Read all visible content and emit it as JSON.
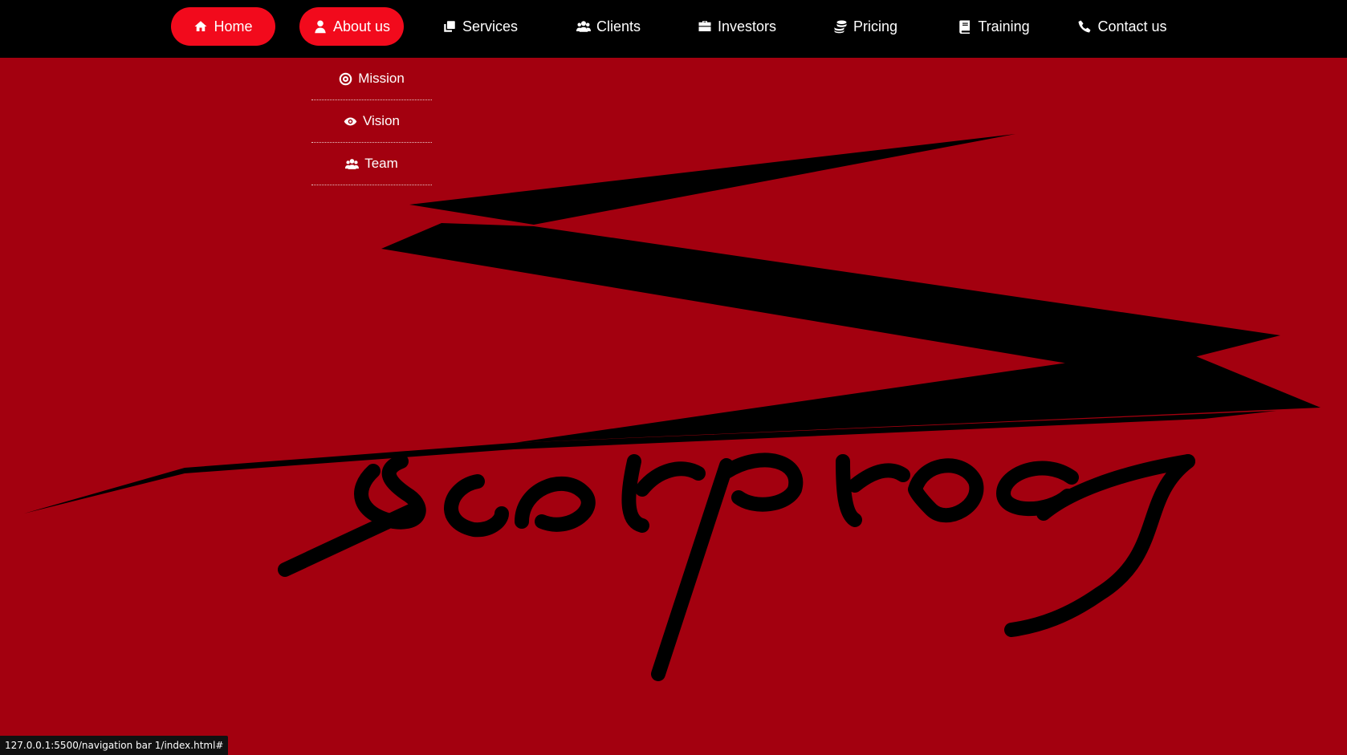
{
  "nav": {
    "items": [
      {
        "label": "Home",
        "icon": "home-icon"
      },
      {
        "label": "About us",
        "icon": "user-icon"
      },
      {
        "label": "Services",
        "icon": "copy-icon"
      },
      {
        "label": "Clients",
        "icon": "users-icon"
      },
      {
        "label": "Investors",
        "icon": "briefcase-icon"
      },
      {
        "label": "Pricing",
        "icon": "coins-icon"
      },
      {
        "label": "Training",
        "icon": "book-icon"
      },
      {
        "label": "Contact us",
        "icon": "phone-icon"
      }
    ]
  },
  "dropdown": {
    "items": [
      {
        "label": "Mission",
        "icon": "target-icon"
      },
      {
        "label": "Vision",
        "icon": "eye-icon"
      },
      {
        "label": "Team",
        "icon": "users-icon"
      }
    ]
  },
  "status_bar": {
    "url": "127.0.0.1:5500/navigation bar 1/index.html#"
  },
  "colors": {
    "background": "#a3000f",
    "nav": "#000000",
    "accent": "#f20a1c",
    "logo": "#000000"
  }
}
